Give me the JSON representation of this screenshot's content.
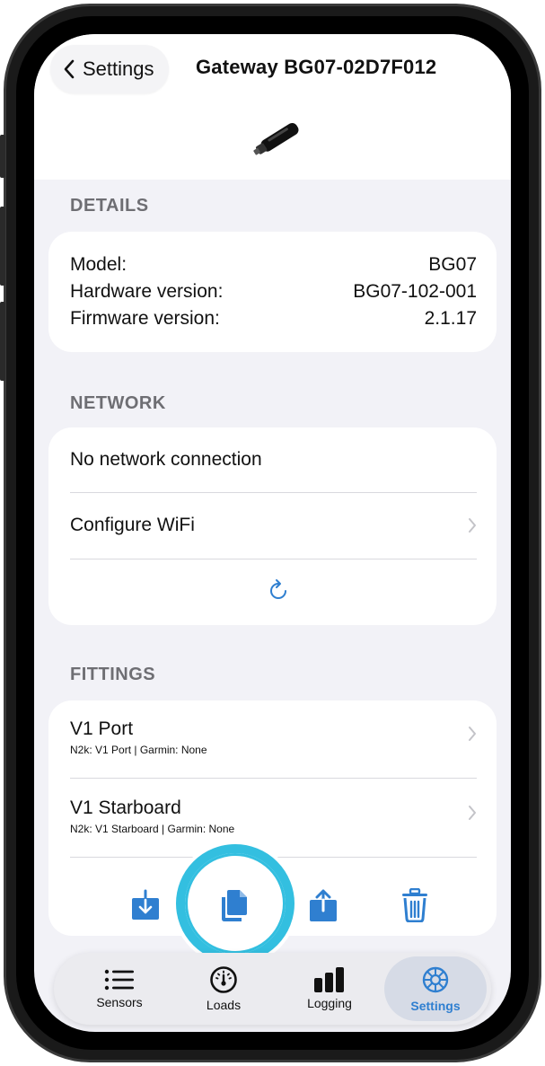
{
  "header": {
    "back_label": "Settings",
    "title": "Gateway BG07-02D7F012"
  },
  "details": {
    "section_label": "DETAILS",
    "rows": [
      {
        "label": "Model:",
        "value": "BG07"
      },
      {
        "label": "Hardware version:",
        "value": "BG07-102-001"
      },
      {
        "label": "Firmware version:",
        "value": "2.1.17"
      }
    ]
  },
  "network": {
    "section_label": "NETWORK",
    "status": "No network connection",
    "configure_label": "Configure WiFi"
  },
  "fittings": {
    "section_label": "FITTINGS",
    "items": [
      {
        "name": "V1 Port",
        "sub": "N2k: V1 Port  |  Garmin: None"
      },
      {
        "name": "V1 Starboard",
        "sub": "N2k: V1 Starboard  |  Garmin: None"
      }
    ]
  },
  "tabs": [
    {
      "label": "Sensors",
      "icon": "list-icon"
    },
    {
      "label": "Loads",
      "icon": "gauge-icon"
    },
    {
      "label": "Logging",
      "icon": "bars-icon"
    },
    {
      "label": "Settings",
      "icon": "gear-icon"
    }
  ],
  "colors": {
    "accent": "#2f7fd0",
    "highlight": "#33bfe0"
  }
}
